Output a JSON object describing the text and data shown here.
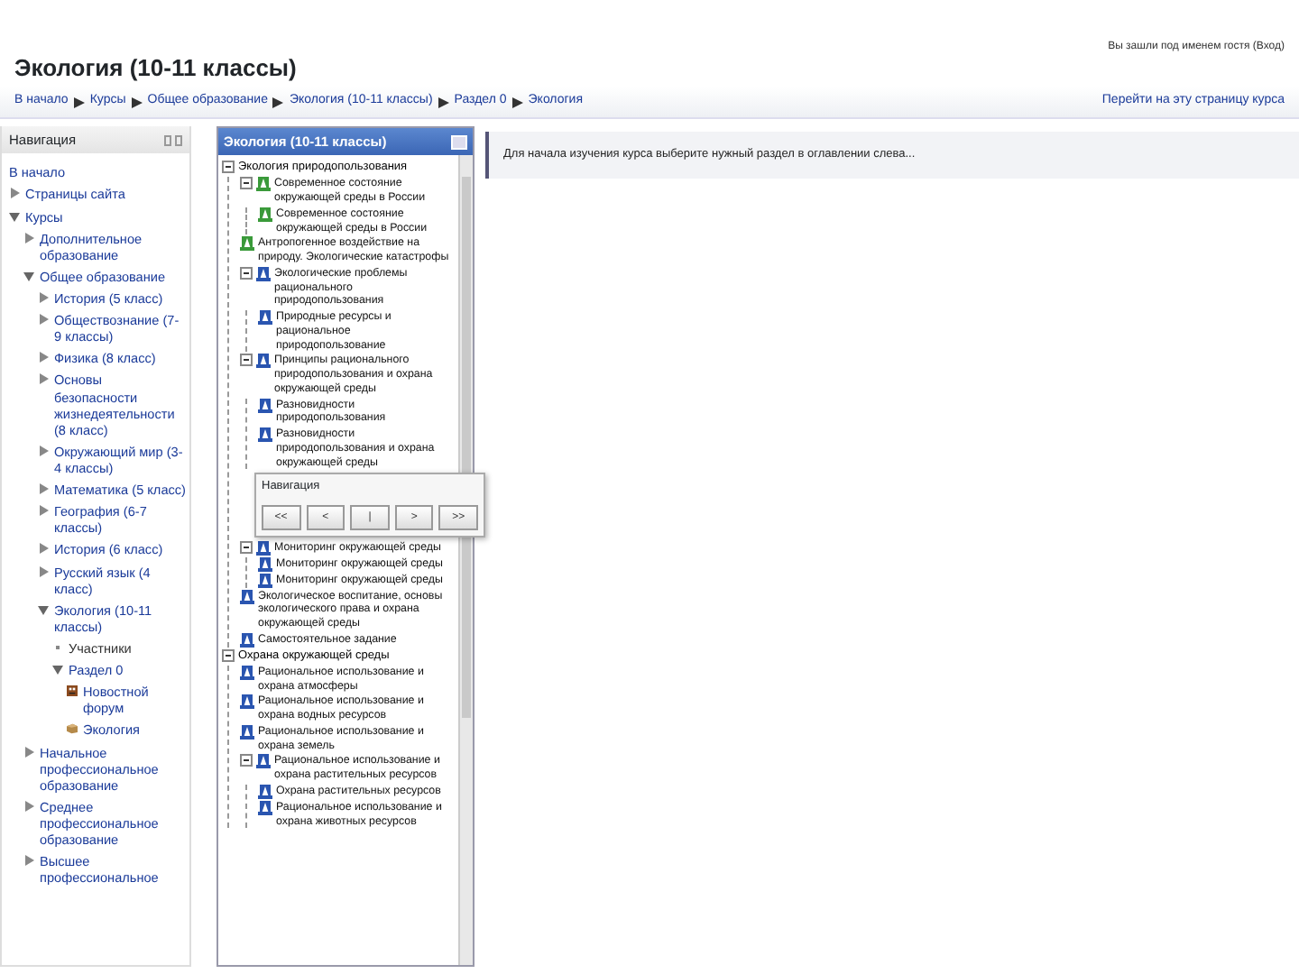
{
  "header": {
    "title": "Экология (10-11 классы)",
    "login_info": "Вы зашли под именем гостя (Вход)"
  },
  "breadcrumb": {
    "items": [
      "В начало",
      "Курсы",
      "Общее образование",
      "Экология (10-11 классы)",
      "Раздел 0",
      "Экология"
    ],
    "action_link": "Перейти на эту страницу курса"
  },
  "navigation": {
    "title": "Навигация",
    "items": [
      {
        "label": "В начало",
        "kind": "link"
      },
      {
        "label": "Страницы сайта",
        "kind": "branch",
        "expanded": false
      },
      {
        "label": "Курсы",
        "kind": "branch",
        "expanded": true,
        "children": [
          {
            "label": "Дополнительное образование",
            "kind": "branch",
            "expanded": false
          },
          {
            "label": "Общее образование",
            "kind": "branch",
            "expanded": true,
            "children": [
              {
                "label": "История (5 класс)",
                "kind": "branch",
                "expanded": false
              },
              {
                "label": "Обществознание (7-9 классы)",
                "kind": "branch",
                "expanded": false
              },
              {
                "label": "Физика (8 класс)",
                "kind": "branch",
                "expanded": false
              },
              {
                "label": "Основы безопасности жизнедеятельности (8 класс)",
                "kind": "branch",
                "expanded": false
              },
              {
                "label": "Окружающий мир (3-4 классы)",
                "kind": "branch",
                "expanded": false
              },
              {
                "label": "Математика (5 класс)",
                "kind": "branch",
                "expanded": false
              },
              {
                "label": "География (6-7 классы)",
                "kind": "branch",
                "expanded": false
              },
              {
                "label": "История (6 класс)",
                "kind": "branch",
                "expanded": false
              },
              {
                "label": "Русский язык (4 класс)",
                "kind": "branch",
                "expanded": false
              },
              {
                "label": "Экология (10-11 классы)",
                "kind": "branch",
                "expanded": true,
                "children": [
                  {
                    "label": "Участники",
                    "kind": "bullet"
                  },
                  {
                    "label": "Раздел 0",
                    "kind": "branch",
                    "expanded": true,
                    "children": [
                      {
                        "label": "Новостной форум",
                        "kind": "forum"
                      },
                      {
                        "label": "Экология",
                        "kind": "package"
                      }
                    ]
                  }
                ]
              }
            ]
          },
          {
            "label": "Начальное профессиональное образование",
            "kind": "branch",
            "expanded": false
          },
          {
            "label": "Среднее профессиональное образование",
            "kind": "branch",
            "expanded": false
          },
          {
            "label": "Высшее профессиональное",
            "kind": "branch",
            "expanded": false
          }
        ]
      }
    ]
  },
  "toc": {
    "title": "Экология (10-11 классы)",
    "items": [
      {
        "label": "Экология природопользования",
        "kind": "section",
        "expanded": true,
        "children": [
          {
            "label": "Современное состояние окружающей среды в России",
            "kind": "complete",
            "expanded": true,
            "children": [
              {
                "label": "Современное состояние окружающей среды в России",
                "kind": "complete"
              }
            ]
          },
          {
            "label": "Антропогенное воздействие на природу. Экологические катастрофы",
            "kind": "complete"
          },
          {
            "label": "Экологические проблемы рационального природопользования",
            "kind": "incomplete",
            "expanded": true,
            "children": [
              {
                "label": "Природные ресурсы и рациональное природопользование",
                "kind": "incomplete"
              }
            ]
          },
          {
            "label": "Принципы рационального природопользования и охрана окружающей среды",
            "kind": "incomplete",
            "expanded": true,
            "children": [
              {
                "label": "Разновидности природопользования",
                "kind": "incomplete"
              },
              {
                "label": "Разновидности природопользования и охрана окружающей среды",
                "kind": "incomplete"
              }
            ]
          },
          {
            "label": "Мониторинг окружающей среды",
            "kind": "incomplete",
            "expanded": true,
            "children": [
              {
                "label": "Мониторинг окружающей среды",
                "kind": "incomplete"
              },
              {
                "label": "Мониторинг окружающей среды",
                "kind": "incomplete"
              }
            ]
          },
          {
            "label": "Экологическое воспитание, основы экологического права и охрана окружающей среды",
            "kind": "incomplete"
          },
          {
            "label": "Самостоятельное задание",
            "kind": "incomplete"
          }
        ]
      },
      {
        "label": "Охрана окружающей среды",
        "kind": "section",
        "expanded": true,
        "children": [
          {
            "label": "Рациональное использование и охрана атмосферы",
            "kind": "incomplete"
          },
          {
            "label": "Рациональное использование и охрана водных ресурсов",
            "kind": "incomplete"
          },
          {
            "label": "Рациональное использование и охрана земель",
            "kind": "incomplete"
          },
          {
            "label": "Рациональное использование и охрана растительных ресурсов",
            "kind": "incomplete",
            "expanded": true,
            "children": [
              {
                "label": "Охрана растительных ресурсов",
                "kind": "incomplete"
              },
              {
                "label": "Рациональное использование и охрана животных ресурсов",
                "kind": "incomplete"
              }
            ]
          }
        ]
      }
    ]
  },
  "nav_popup": {
    "title": "Навигация",
    "buttons": [
      "<<",
      "<",
      "|",
      ">",
      ">>"
    ]
  },
  "content": {
    "message": "Для начала изучения курса выберите нужный раздел в оглавлении слева..."
  }
}
